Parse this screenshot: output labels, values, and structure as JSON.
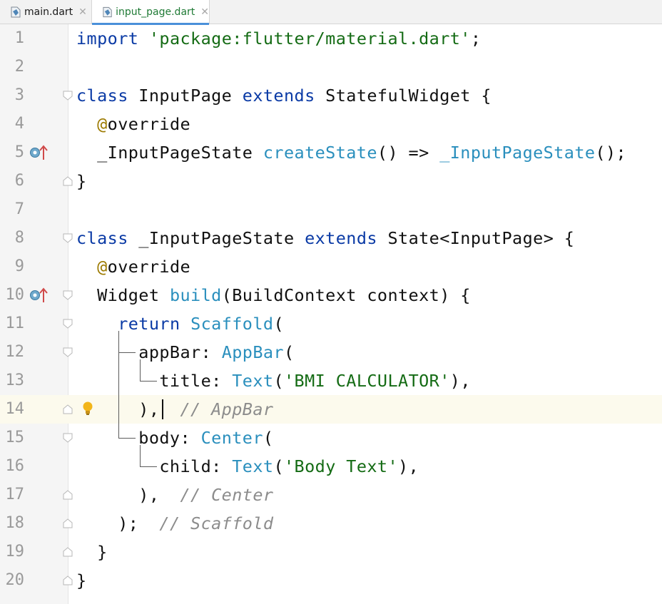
{
  "tabs": [
    {
      "label": "main.dart",
      "active": false
    },
    {
      "label": "input_page.dart",
      "active": true
    }
  ],
  "lines": [
    {
      "n": "1",
      "tokens": [
        [
          "kw",
          "import"
        ],
        [
          "p",
          " "
        ],
        [
          "str",
          "'package:flutter/material.dart'"
        ],
        [
          "p",
          ";"
        ]
      ]
    },
    {
      "n": "2",
      "tokens": []
    },
    {
      "n": "3",
      "tokens": [
        [
          "kw",
          "class"
        ],
        [
          "p",
          " InputPage "
        ],
        [
          "kw",
          "extends"
        ],
        [
          "p",
          " StatefulWidget {"
        ]
      ]
    },
    {
      "n": "4",
      "tokens": [
        [
          "p",
          "  "
        ],
        [
          "ann",
          "@"
        ],
        [
          "p",
          "override"
        ]
      ]
    },
    {
      "n": "5",
      "tokens": [
        [
          "p",
          "  _InputPageState "
        ],
        [
          "ty",
          "createState"
        ],
        [
          "p",
          "() => "
        ],
        [
          "ty",
          "_InputPageState"
        ],
        [
          "p",
          "();"
        ]
      ]
    },
    {
      "n": "6",
      "tokens": [
        [
          "p",
          "}"
        ]
      ]
    },
    {
      "n": "7",
      "tokens": []
    },
    {
      "n": "8",
      "tokens": [
        [
          "kw",
          "class"
        ],
        [
          "p",
          " _InputPageState "
        ],
        [
          "kw",
          "extends"
        ],
        [
          "p",
          " State<InputPage> {"
        ]
      ]
    },
    {
      "n": "9",
      "tokens": [
        [
          "p",
          "  "
        ],
        [
          "ann",
          "@"
        ],
        [
          "p",
          "override"
        ]
      ]
    },
    {
      "n": "10",
      "tokens": [
        [
          "p",
          "  Widget "
        ],
        [
          "ty",
          "build"
        ],
        [
          "p",
          "(BuildContext context) {"
        ]
      ]
    },
    {
      "n": "11",
      "tokens": [
        [
          "p",
          "    "
        ],
        [
          "kw",
          "return"
        ],
        [
          "p",
          " "
        ],
        [
          "ty",
          "Scaffold"
        ],
        [
          "p",
          "("
        ]
      ]
    },
    {
      "n": "12",
      "tokens": [
        [
          "p",
          "      appBar: "
        ],
        [
          "ty",
          "AppBar"
        ],
        [
          "p",
          "("
        ]
      ]
    },
    {
      "n": "13",
      "tokens": [
        [
          "p",
          "        title: "
        ],
        [
          "ty",
          "Text"
        ],
        [
          "p",
          "("
        ],
        [
          "str",
          "'BMI CALCULATOR'"
        ],
        [
          "p",
          "),"
        ]
      ]
    },
    {
      "n": "14",
      "tokens": [
        [
          "p",
          "      ),  "
        ],
        [
          "cm",
          "// AppBar"
        ]
      ]
    },
    {
      "n": "15",
      "tokens": [
        [
          "p",
          "      body: "
        ],
        [
          "ty",
          "Center"
        ],
        [
          "p",
          "("
        ]
      ]
    },
    {
      "n": "16",
      "tokens": [
        [
          "p",
          "        child: "
        ],
        [
          "ty",
          "Text"
        ],
        [
          "p",
          "("
        ],
        [
          "str",
          "'Body Text'"
        ],
        [
          "p",
          "),"
        ]
      ]
    },
    {
      "n": "17",
      "tokens": [
        [
          "p",
          "      ),  "
        ],
        [
          "cm",
          "// Center"
        ]
      ]
    },
    {
      "n": "18",
      "tokens": [
        [
          "p",
          "    );  "
        ],
        [
          "cm",
          "// Scaffold"
        ]
      ]
    },
    {
      "n": "19",
      "tokens": [
        [
          "p",
          "  }"
        ]
      ]
    },
    {
      "n": "20",
      "tokens": [
        [
          "p",
          "}"
        ]
      ]
    }
  ],
  "highlighted_line": "14",
  "gutter_icons": [
    {
      "line": "5",
      "icon": "override-up-icon"
    },
    {
      "line": "10",
      "icon": "override-up-icon"
    },
    {
      "line": "14",
      "icon": "bulb-icon"
    }
  ],
  "colors": {
    "keyword": "#0a3aa5",
    "string": "#146b14",
    "annotation": "#9c7a00",
    "type": "#2a8fbd",
    "comment": "#8c8c8c",
    "highlight": "#fcfaed"
  }
}
